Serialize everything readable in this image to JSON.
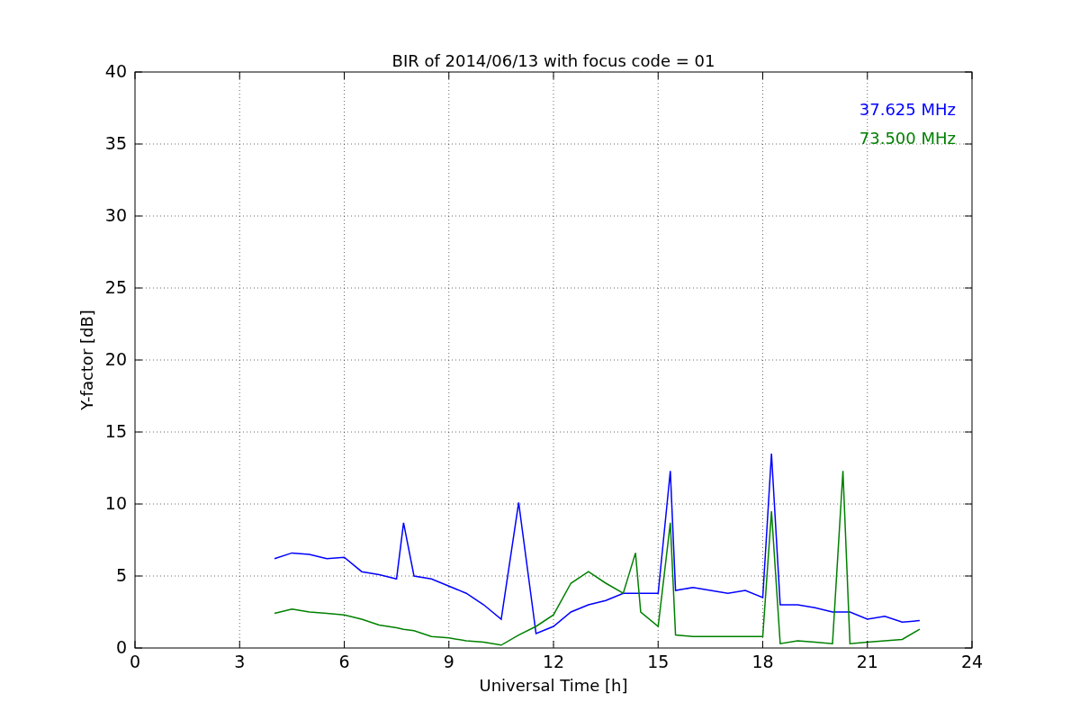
{
  "figure": {
    "chart_data": {
      "type": "line",
      "title": "BIR of 2014/06/13 with focus code = 01",
      "xlabel": "Universal Time [h]",
      "ylabel": "Y-factor [dB]",
      "x": [
        4.0,
        4.5,
        5.0,
        5.5,
        6.0,
        6.5,
        7.0,
        7.5,
        7.7,
        8.0,
        8.5,
        9.0,
        9.5,
        10.0,
        10.5,
        11.0,
        11.5,
        12.0,
        12.5,
        13.0,
        13.5,
        14.0,
        14.35,
        14.5,
        15.0,
        15.35,
        15.5,
        16.0,
        16.5,
        17.0,
        17.5,
        18.0,
        18.25,
        18.5,
        19.0,
        19.5,
        20.0,
        20.3,
        20.5,
        21.0,
        21.5,
        22.0,
        22.5
      ],
      "series": [
        {
          "name": "37.625 MHz",
          "color": "#0000ff",
          "values": [
            6.2,
            6.6,
            6.5,
            6.2,
            6.3,
            5.3,
            5.1,
            4.8,
            8.7,
            5.0,
            4.8,
            4.3,
            3.8,
            3.0,
            2.0,
            10.1,
            1.0,
            1.5,
            2.5,
            3.0,
            3.3,
            3.8,
            3.8,
            3.8,
            3.8,
            12.3,
            4.0,
            4.2,
            4.0,
            3.8,
            4.0,
            3.5,
            13.5,
            3.0,
            3.0,
            2.8,
            2.5,
            2.5,
            2.5,
            2.0,
            2.2,
            1.8,
            1.9
          ]
        },
        {
          "name": "73.500 MHz",
          "color": "#008000",
          "values": [
            2.4,
            2.7,
            2.5,
            2.4,
            2.3,
            2.0,
            1.6,
            1.4,
            1.3,
            1.2,
            0.8,
            0.7,
            0.5,
            0.4,
            0.2,
            0.9,
            1.5,
            2.3,
            4.5,
            5.3,
            4.5,
            3.8,
            6.6,
            2.5,
            1.5,
            8.7,
            0.9,
            0.8,
            0.8,
            0.8,
            0.8,
            0.8,
            9.5,
            0.3,
            0.5,
            0.4,
            0.3,
            12.3,
            0.3,
            0.4,
            0.5,
            0.6,
            1.3
          ]
        }
      ],
      "xlim": [
        0,
        24
      ],
      "ylim": [
        0,
        40
      ],
      "xticks": [
        0,
        3,
        6,
        9,
        12,
        15,
        18,
        21,
        24
      ],
      "yticks": [
        0,
        5,
        10,
        15,
        20,
        25,
        30,
        35,
        40
      ],
      "grid": true
    }
  }
}
